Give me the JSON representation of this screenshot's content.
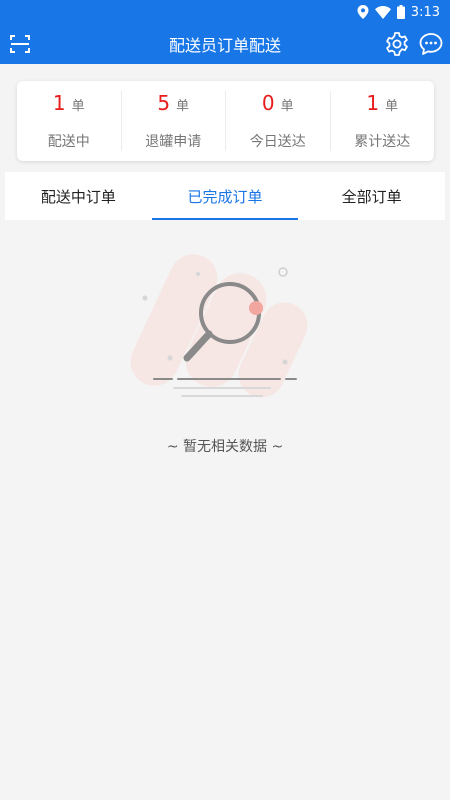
{
  "status_bar": {
    "time": "3:13"
  },
  "header": {
    "title": "配送员订单配送"
  },
  "stats": [
    {
      "value": "1",
      "unit": "单",
      "label": "配送中"
    },
    {
      "value": "5",
      "unit": "单",
      "label": "退罐申请"
    },
    {
      "value": "0",
      "unit": "单",
      "label": "今日送达"
    },
    {
      "value": "1",
      "unit": "单",
      "label": "累计送达"
    }
  ],
  "tabs": [
    {
      "label": "配送中订单",
      "active": false
    },
    {
      "label": "已完成订单",
      "active": true
    },
    {
      "label": "全部订单",
      "active": false
    }
  ],
  "empty_state": {
    "text": "~ 暂无相关数据 ~"
  },
  "colors": {
    "primary": "#1976e6",
    "accent_red": "#e91c1c",
    "background": "#f4f4f4"
  }
}
